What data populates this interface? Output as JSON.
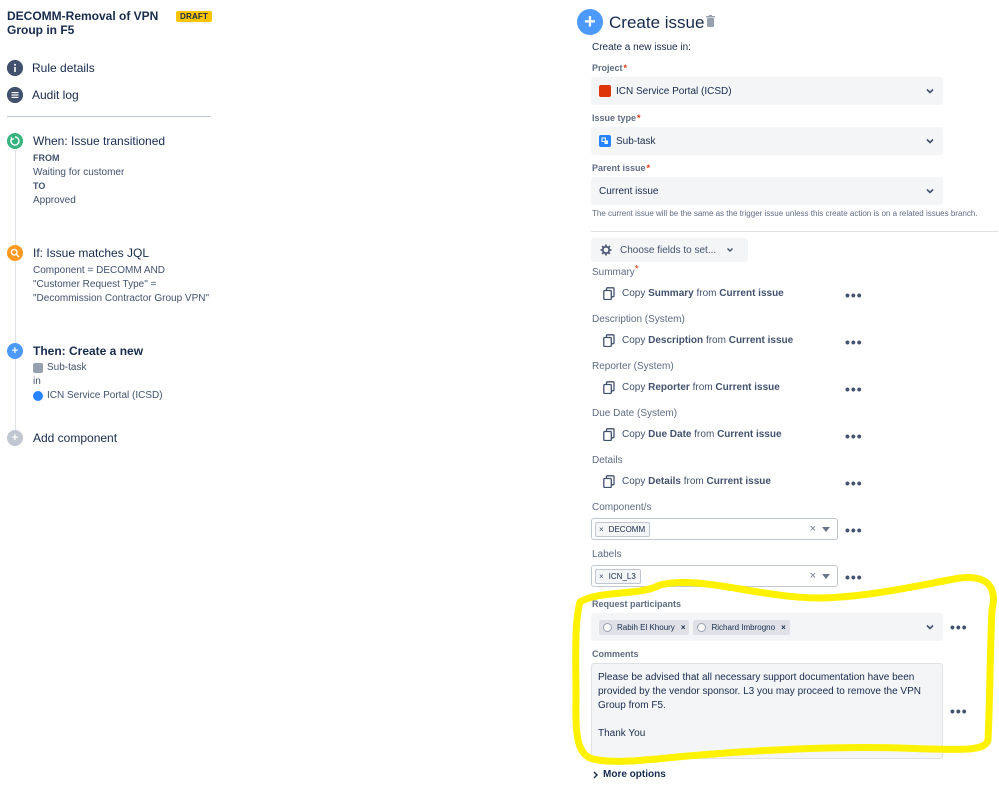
{
  "rule": {
    "title": "DECOMM-Removal of VPN Group in F5",
    "status_badge": "DRAFT"
  },
  "nav": {
    "rule_details": "Rule details",
    "audit_log": "Audit log"
  },
  "steps": {
    "trigger": {
      "heading": "When: Issue transitioned",
      "from_label": "FROM",
      "from_value": "Waiting for customer",
      "to_label": "TO",
      "to_value": "Approved",
      "color": "#36b37e"
    },
    "condition": {
      "heading": "If: Issue matches JQL",
      "jql_line1": "Component = DECOMM AND",
      "jql_line2": "\"Customer Request Type\" =",
      "jql_line3": "\"Decommission Contractor Group VPN\"",
      "color": "#ff991f"
    },
    "action": {
      "heading": "Then: Create a new",
      "issue_type": "Sub-task",
      "in_label": "in",
      "project": "ICN Service Portal (ICSD)",
      "color": "#4c9aff"
    },
    "add_component": "Add component"
  },
  "create_issue": {
    "title": "Create issue",
    "intro": "Create a new issue in:",
    "project_label": "Project",
    "project_value": "ICN Service Portal (ICSD)",
    "issue_type_label": "Issue type",
    "issue_type_value": "Sub-task",
    "parent_label": "Parent issue",
    "parent_value": "Current issue",
    "parent_help": "The current issue will be the same as the trigger issue unless this create action is on a related issues branch.",
    "choose_fields": "Choose fields to set...",
    "fields": [
      {
        "label": "Summary",
        "required": true,
        "copy": "Copy",
        "field": "Summary",
        "from": "from",
        "source": "Current issue"
      },
      {
        "label": "Description (System)",
        "required": false,
        "copy": "Copy",
        "field": "Description",
        "from": "from",
        "source": "Current issue"
      },
      {
        "label": "Reporter (System)",
        "required": false,
        "copy": "Copy",
        "field": "Reporter",
        "from": "from",
        "source": "Current issue"
      },
      {
        "label": "Due Date (System)",
        "required": false,
        "copy": "Copy",
        "field": "Due Date",
        "from": "from",
        "source": "Current issue"
      },
      {
        "label": "Details",
        "required": false,
        "copy": "Copy",
        "field": "Details",
        "from": "from",
        "source": "Current issue"
      }
    ],
    "components_label": "Component/s",
    "components_tag": "DECOMM",
    "labels_label": "Labels",
    "labels_tag": "ICN_L3",
    "participants_label": "Request participants",
    "participants": [
      "Rabih El Khoury",
      "Richard Imbrogno"
    ],
    "comments_label": "Comments",
    "comment_line1": "Please be advised that all necessary support documentation have been",
    "comment_line2": "provided by the vendor sponsor. L3 you may proceed to remove the VPN",
    "comment_line3": "Group from F5.",
    "comment_line4": "Thank You",
    "more_options": "More options"
  },
  "colors": {
    "accent": "#4c9aff",
    "draft": "#ffc400",
    "highlight": "#fff200",
    "required": "#de350b"
  }
}
